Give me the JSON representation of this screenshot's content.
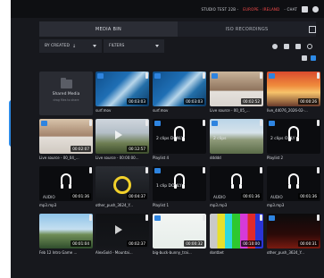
{
  "topbar": {
    "studio": "STUDIO TEST 22B -",
    "region": "EUROPE - IRELAND",
    "chat": "- CHAT"
  },
  "tabs": {
    "media_bin": "MEDIA BIN",
    "iso_recordings": "ISO RECORDINGS"
  },
  "filters": {
    "sort_label": "BY CREATED",
    "sort_arrow": "↓",
    "filters_label": "FILTERS"
  },
  "accent_color": "#2d8ae6",
  "items": [
    {
      "kind": "shared",
      "title": "Shared Media",
      "subtitle": "drag files to share"
    },
    {
      "kind": "video",
      "caption": "surf.mov",
      "duration": "00:03:03"
    },
    {
      "kind": "video",
      "caption": "surf.mov",
      "duration": "00:03:03"
    },
    {
      "kind": "video",
      "caption": "Live source - 00_05_...",
      "duration": "00:02:52"
    },
    {
      "kind": "video",
      "caption": "live_44076_2026-02-...",
      "duration": "00:00:26"
    },
    {
      "kind": "video",
      "caption": "Live source - 00_04_...",
      "duration": "00:02:07"
    },
    {
      "kind": "video",
      "caption": "Live source - 00:00:00...",
      "duration": "00:12:57"
    },
    {
      "kind": "playlist",
      "caption": "Playlist 4",
      "clips": "2 clips",
      "badge": "DONLY"
    },
    {
      "kind": "playlist",
      "caption": "ddddd",
      "clips": "2 clips"
    },
    {
      "kind": "playlist",
      "caption": "Playlist 2",
      "clips": "2 clips",
      "badge": "ONLY"
    },
    {
      "kind": "audio",
      "caption": "mp3.mp3",
      "audio": "AUDIO",
      "duration": "00:01:36"
    },
    {
      "kind": "video",
      "caption": "other_push_3624_Y...",
      "duration": "00:04:37"
    },
    {
      "kind": "playlist",
      "caption": "Playlist 1",
      "clips": "1 clip",
      "badge": "DONLY"
    },
    {
      "kind": "audio",
      "caption": "mp3.mp3",
      "audio": "AUDIO",
      "duration": "00:01:36"
    },
    {
      "kind": "audio",
      "caption": "mp3.mp3",
      "audio": "AUDIO",
      "duration": "00:01:36"
    },
    {
      "kind": "video",
      "caption": "Feb 12 Intro Game ...",
      "duration": "00:01:04"
    },
    {
      "kind": "video",
      "caption": "AlexGold - Mountai...",
      "duration": "00:02:37"
    },
    {
      "kind": "video",
      "caption": "big-buck-bunny_trai...",
      "duration": "00:00:32"
    },
    {
      "kind": "video",
      "caption": "dontbet",
      "duration": "00:10:00"
    },
    {
      "kind": "video",
      "caption": "other_push_3624_Y...",
      "duration": "00:00:31"
    }
  ]
}
